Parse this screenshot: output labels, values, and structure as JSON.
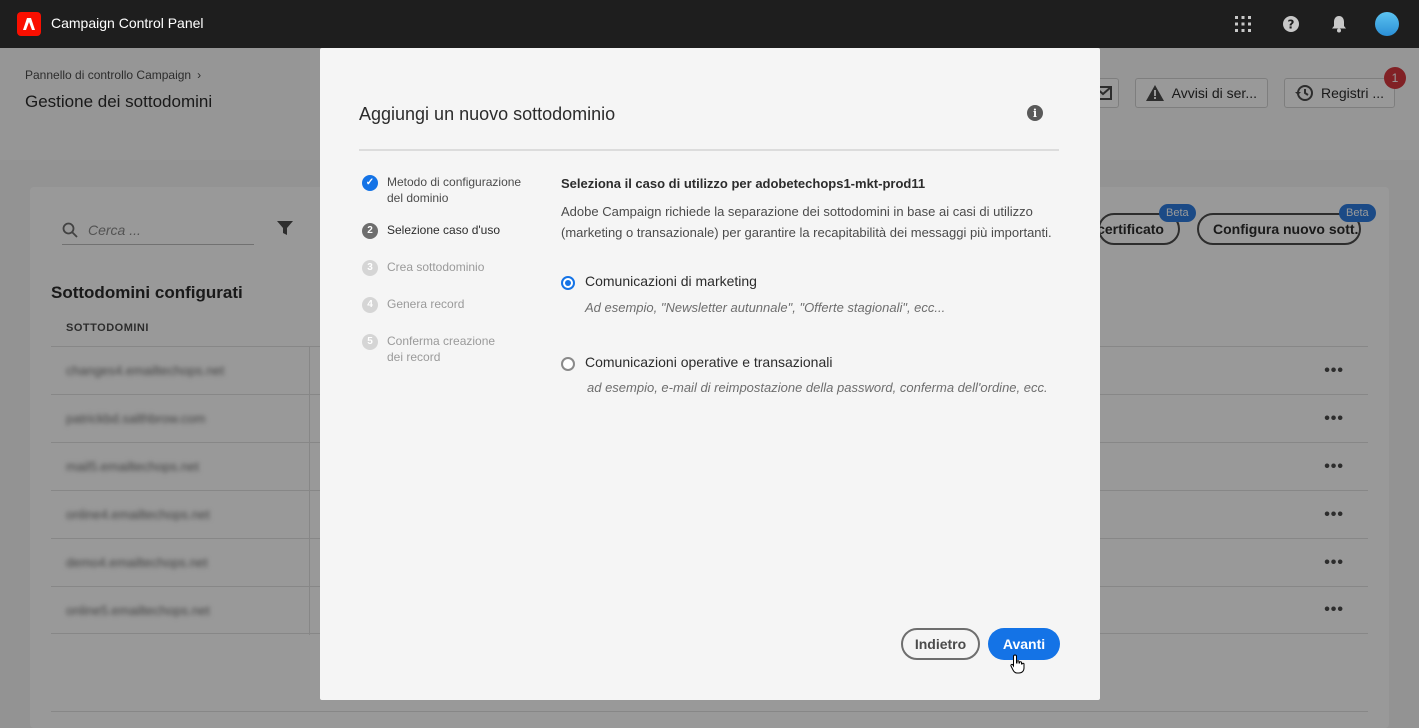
{
  "app": {
    "title": "Campaign Control Panel"
  },
  "header": {
    "breadcrumb": "Pannello di controllo Campaign",
    "title": "Gestione dei sottodomini",
    "actions": {
      "alerts_label": "Avvisi di ser...",
      "logs_label": "Registri ...",
      "logs_badge": "1"
    }
  },
  "card": {
    "search_placeholder": "Cerca ...",
    "cert_button": "i certificato",
    "config_button": "Configura nuovo sott...",
    "beta": "Beta",
    "section_title": "Sottodomini configurati",
    "column_header": "SOTTODOMINI",
    "rows": [
      "changes4.emailtechops.net",
      "patrickbd.salthbrow.com",
      "mail5.emailtechops.net",
      "online4.emailtechops.net",
      "demo4.emailtechops.net",
      "online5.emailtechops.net"
    ],
    "row_menu": "•••"
  },
  "modal": {
    "title": "Aggiungi un nuovo sottodominio",
    "info_icon": "i",
    "steps": [
      {
        "num": "✓",
        "label": "Metodo di configurazione del dominio",
        "state": "done"
      },
      {
        "num": "2",
        "label": "Selezione caso d'uso",
        "state": "active"
      },
      {
        "num": "3",
        "label": "Crea sottodominio",
        "state": "pending"
      },
      {
        "num": "4",
        "label": "Genera record",
        "state": "pending"
      },
      {
        "num": "5",
        "label": "Conferma creazione dei record",
        "state": "pending"
      }
    ],
    "content_head": "Seleziona il caso di utilizzo per adobetechops1-mkt-prod11",
    "content_desc": "Adobe Campaign richiede la separazione dei sottodomini in base ai casi di utilizzo (marketing o transazionale) per garantire la recapitabilità dei messaggi più importanti.",
    "options": [
      {
        "label": "Comunicazioni di marketing",
        "hint": "Ad esempio, \"Newsletter autunnale\", \"Offerte stagionali\", ecc...",
        "checked": true
      },
      {
        "label": "Comunicazioni operative e transazionali",
        "hint": "ad esempio, e-mail di reimpostazione della password, conferma dell'ordine, ecc.",
        "checked": false
      }
    ],
    "back_button": "Indietro",
    "next_button": "Avanti"
  },
  "colors": {
    "accent": "#1473e6",
    "badge": "#d7373f",
    "topbar": "#1e1e1e",
    "logo": "#fa0f00"
  },
  "icons": [
    "adobe-logo-icon",
    "apps-grid-icon",
    "help-icon",
    "bell-icon",
    "avatar",
    "envelope-icon",
    "warning-icon",
    "history-icon",
    "search-icon",
    "filter-icon",
    "info-icon",
    "checkmark-icon",
    "hand-cursor-icon"
  ]
}
